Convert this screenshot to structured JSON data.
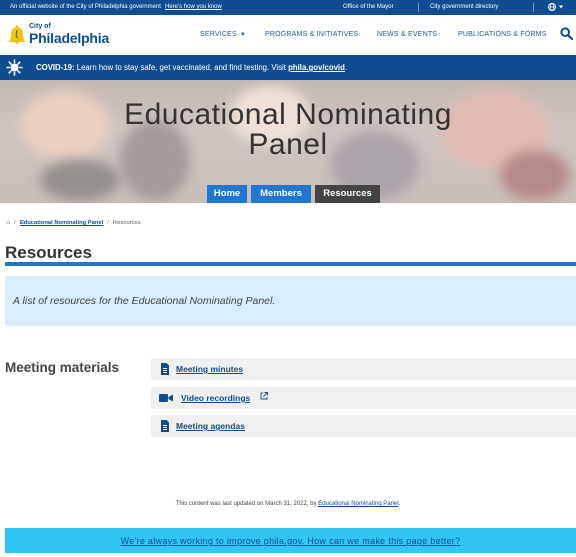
{
  "topbar": {
    "official_text": "An official website of the City of Philadelphia government",
    "how_link": "Here's how you know",
    "mayor_link": "Office of the Mayor",
    "directory_link": "City government directory",
    "globe_icon": "globe-icon"
  },
  "header": {
    "logo_small": "City of",
    "logo_big": "Philadelphia",
    "nav": [
      {
        "label": "SERVICES"
      },
      {
        "label": "PROGRAMS & INITIATIVES"
      },
      {
        "label": "NEWS & EVENTS"
      },
      {
        "label": "PUBLICATIONS & FORMS"
      }
    ],
    "search_icon": "search-icon"
  },
  "alert": {
    "label": "COVID-19:",
    "text": "Learn how to stay safe, get vaccinated, and find testing. Visit",
    "link": "phila.gov/covid",
    "end": "."
  },
  "hero": {
    "title_line1": "Educational Nominating",
    "title_line2": "Panel",
    "tabs": [
      {
        "label": "Home",
        "active": false
      },
      {
        "label": "Members",
        "active": false
      },
      {
        "label": "Resources",
        "active": true
      }
    ]
  },
  "breadcrumb": {
    "home_icon": "home-icon",
    "parent": "Educational Nominating Panel",
    "current": "Resources"
  },
  "page": {
    "title": "Resources",
    "intro": "A list of resources for the Educational Nominating Panel."
  },
  "materials": {
    "heading": "Meeting materials",
    "items": [
      {
        "label": "Meeting minutes",
        "icon": "document-icon"
      },
      {
        "label": "Video recordings",
        "icon": "video-icon",
        "external": true
      },
      {
        "label": "Meeting agendas",
        "icon": "document-icon"
      }
    ]
  },
  "footer": {
    "updated_text": "This content was last updated on March 31, 2022, by",
    "updated_link": "Educational Nominating Panel",
    "updated_end": ".",
    "feedback": "We're always working to improve phila.gov. How can we make this page better?"
  },
  "colors": {
    "brand_blue": "#0f4d90",
    "accent_blue": "#2176d2",
    "light_blue": "#daedfe",
    "feedback_bg": "#2fc6f1"
  }
}
